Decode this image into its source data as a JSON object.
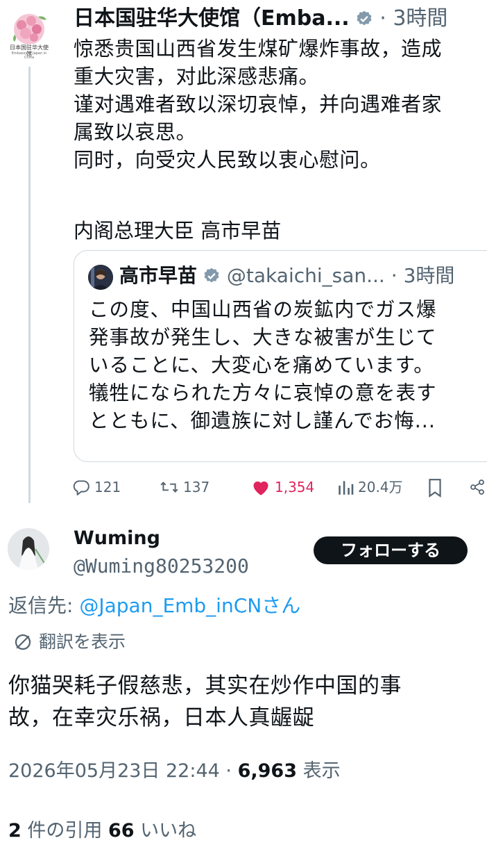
{
  "colors": {
    "accent": "#1d9bf0",
    "like": "#e0245e",
    "text": "#0f1419",
    "muted": "#536471",
    "border": "#cfd9de"
  },
  "main_tweet": {
    "author_name": "日本国驻华大使馆（Emba...",
    "time_sep": "·",
    "time": "3時間",
    "logo_text": "日本国驻华大使馆",
    "logo_subtext": "Embassy of Japan in China",
    "text": "惊悉贵国山西省发生煤矿爆炸事故，造成\n重大灾害，对此深感悲痛。\n谨对遇难者致以深切哀悼，并向遇难者家\n属致以哀思。\n同时，向受灾人民致以衷心慰问。",
    "signature": "内阁总理大臣 高市早苗"
  },
  "quoted_tweet": {
    "author_name": "高市早苗",
    "handle": "@takaichi_san...",
    "time_sep": "·",
    "time": "3時間",
    "text": "この度、中国山西省の炭鉱内でガス爆\n発事故が発生し、大きな被害が生じて\nいることに、大変心を痛めています。\n犠牲になられた方々に哀悼の意を表す\nとともに、御遺族に対し謹んでお悔..."
  },
  "actions": {
    "replies": "121",
    "retweets": "137",
    "likes": "1,354",
    "views": "20.4万"
  },
  "reply_tweet": {
    "author_name": "Wuming",
    "handle": "@Wuming80253200",
    "follow_label": "フォローする",
    "reply_to_label": "返信先: ",
    "reply_to_link": "@Japan_Emb_inCN",
    "reply_to_suffix": "さん",
    "translate_label": "翻訳を表示",
    "text": "你猫哭耗子假慈悲，其实在炒作中国的事\n故，在幸灾乐祸，日本人真龌龊",
    "timestamp": "2026年05月23日 22:44",
    "time_sep": " · ",
    "views": "6,963",
    "views_label": " 表示",
    "quotes_count": "2",
    "quotes_label": "件の引用",
    "likes_count": "66",
    "likes_label": "いいね"
  }
}
